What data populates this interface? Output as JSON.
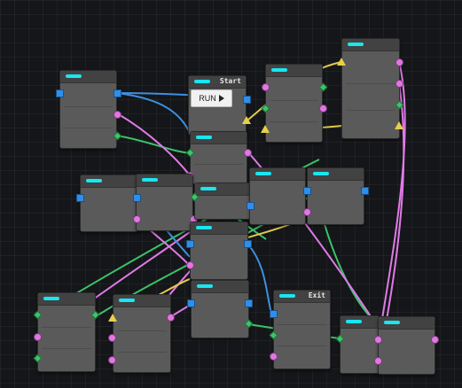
{
  "app": {
    "canvas": "node-graph-editor",
    "background_color": "#141619",
    "node_accent_color": "#19e6f0"
  },
  "port_colors": {
    "square": "#2f8fe8",
    "circle": "#e276e2",
    "diamond": "#3ec46a",
    "triangle": "#e7cf4a"
  },
  "wire_colors": {
    "blue": "#3d8fe0",
    "pink": "#e07ae6",
    "green": "#3cc268",
    "yellow": "#e2c94c"
  },
  "nodes": {
    "start": {
      "title": "Start",
      "run_label": "RUN"
    },
    "exit": {
      "title": "Exit"
    }
  }
}
